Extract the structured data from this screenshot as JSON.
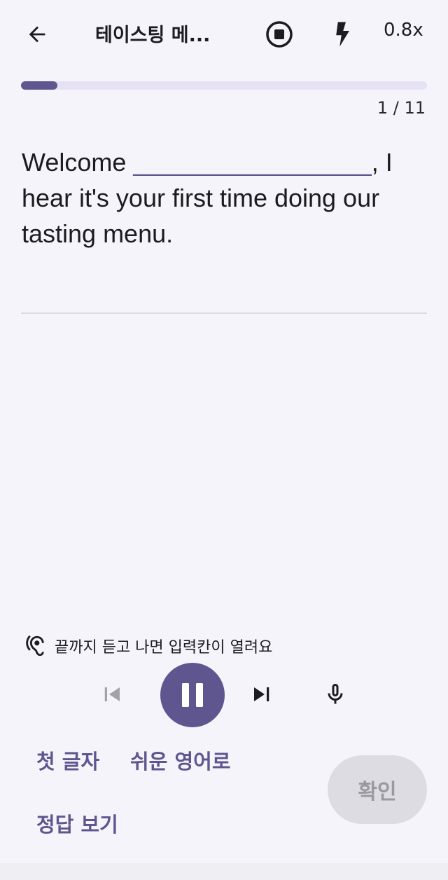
{
  "header": {
    "title": "테이스팅 메...",
    "speed": "0.8x",
    "icons": {
      "back": "arrow-left-icon",
      "stop": "stop-circle-icon",
      "flash": "bolt-icon"
    }
  },
  "progress": {
    "current": 1,
    "total": 11,
    "text": "1 / 11",
    "fraction": 0.09
  },
  "sentence": {
    "before": "Welcome ",
    "blank": "_________________",
    "after": ", I hear it's your first time doing our tasting menu."
  },
  "hint": {
    "icon": "ear-icon",
    "text": "끝까지 듣고 나면 입력칸이 열려요"
  },
  "player": {
    "icons": {
      "prev": "skip-previous-icon",
      "play_state": "pause-icon",
      "next": "skip-next-icon",
      "mic": "microphone-icon"
    }
  },
  "actions": {
    "first_letter": "첫 글자",
    "easy_english": "쉬운 영어로",
    "show_answer": "정답 보기",
    "confirm": "확인"
  },
  "colors": {
    "accent": "#5f5690",
    "progress_track": "#e6e1f5",
    "background": "#f5f4fa",
    "disabled_button": "#dddce2",
    "disabled_text": "#9a99a0"
  }
}
